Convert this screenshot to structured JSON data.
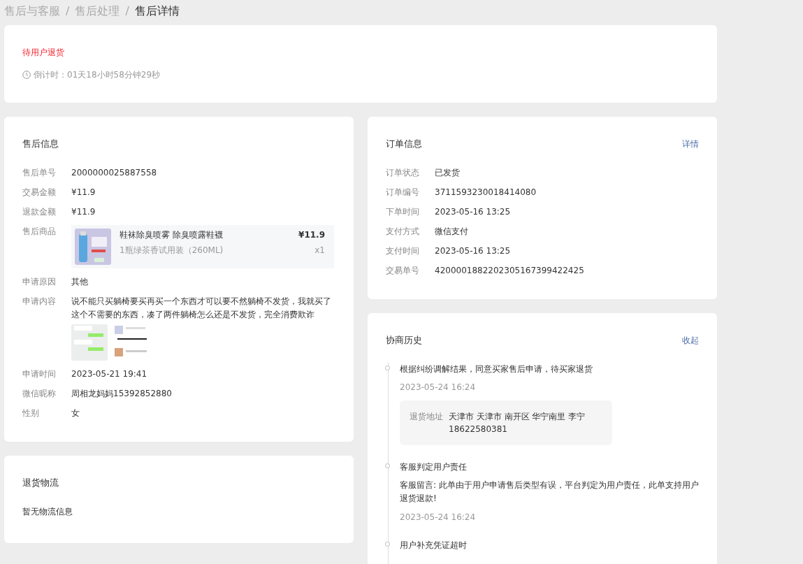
{
  "breadcrumb": [
    {
      "label": "售后与客服",
      "current": false,
      "separator": "/"
    },
    {
      "label": "售后处理",
      "current": false,
      "separator": "/"
    },
    {
      "label": "售后详情",
      "current": true
    }
  ],
  "status": {
    "title": "待用户退货",
    "countdown": "倒计时：01天18小时58分钟29秒"
  },
  "aftersale": {
    "title": "售后信息",
    "fields": [
      {
        "kind": "text",
        "label": "售后单号",
        "value": "2000000025887558"
      },
      {
        "kind": "text",
        "label": "交易金额",
        "value": "¥11.9"
      },
      {
        "kind": "text",
        "label": "退款金额",
        "value": "¥11.9"
      },
      {
        "kind": "product",
        "label": "售后商品",
        "name": "鞋袜除臭喷雾 除臭喷露鞋襪",
        "spec": "1瓶绿茶香试用装（260ML)",
        "price": "¥11.9",
        "qty": "x1"
      },
      {
        "kind": "text",
        "label": "申请原因",
        "value": "其他"
      },
      {
        "kind": "content",
        "label": "申请内容",
        "value": "说不能只买躺椅要买再买一个东西才可以要不然躺椅不发货，我就买了这个不需要的东西，凑了两件躺椅怎么还是不发货，完全消费欺诈"
      },
      {
        "kind": "text",
        "label": "申请时间",
        "value": "2023-05-21 19:41"
      },
      {
        "kind": "text",
        "label": "微信昵称",
        "value": "周相龙妈妈15392852880"
      },
      {
        "kind": "text",
        "label": "性别",
        "value": "女"
      }
    ]
  },
  "logistics": {
    "title": "退货物流",
    "message": "暂无物流信息"
  },
  "order": {
    "title": "订单信息",
    "link": "详情",
    "fields": [
      {
        "label": "订单状态",
        "value": "已发货"
      },
      {
        "label": "订单编号",
        "value": "3711593230018414080"
      },
      {
        "label": "下单时间",
        "value": "2023-05-16 13:25"
      },
      {
        "label": "支付方式",
        "value": "微信支付"
      },
      {
        "label": "支付时间",
        "value": "2023-05-16 13:25"
      },
      {
        "label": "交易单号",
        "value": "4200001882202305167399422425"
      }
    ]
  },
  "history": {
    "title": "协商历史",
    "link": "收起",
    "items": [
      {
        "title": "根据纠纷调解结果，同意买家售后申请，待买家退货",
        "time": "2023-05-24 16:24",
        "address": {
          "label": "退货地址",
          "value": "天津市 天津市 南开区 华宁南里 李宁 18622580381"
        }
      },
      {
        "title": "客服判定用户责任",
        "note": "客服留言: 此单由于用户申请售后类型有误，平台判定为用户责任，此单支持用户退货退款!",
        "time": "2023-05-24 16:24"
      },
      {
        "title": "用户补充凭证超时"
      }
    ]
  }
}
